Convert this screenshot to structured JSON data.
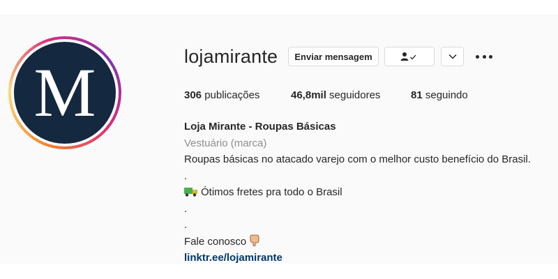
{
  "profile": {
    "avatar_letter": "M",
    "username": "lojamirante",
    "message_button": "Enviar mensagem",
    "follow_icon": "person-check-icon",
    "chevron_icon": "chevron-down-icon",
    "more_icon": "more-options-icon"
  },
  "stats": {
    "posts_count": "306",
    "posts_label": "publicações",
    "followers_count": "46,8mil",
    "followers_label": "seguidores",
    "following_count": "81",
    "following_label": "seguindo"
  },
  "bio": {
    "name": "Loja Mirante - Roupas Básicas",
    "category": "Vestuário (marca)",
    "line1": "Roupas básicas no atacado varejo com o melhor custo benefício do Brasil.",
    "dot1": ".",
    "shipping_icon": "delivery-truck-icon",
    "line2": "Ótimos fretes pra todo o Brasil",
    "dot2": ".",
    "dot3": ".",
    "line3": "Fale conosco",
    "hand_icon": "pointing-down-hand-icon",
    "link": "linktr.ee/lojamirante"
  },
  "colors": {
    "avatar_bg": "#14283f",
    "link": "#00376b",
    "category": "#8e8e8e"
  }
}
